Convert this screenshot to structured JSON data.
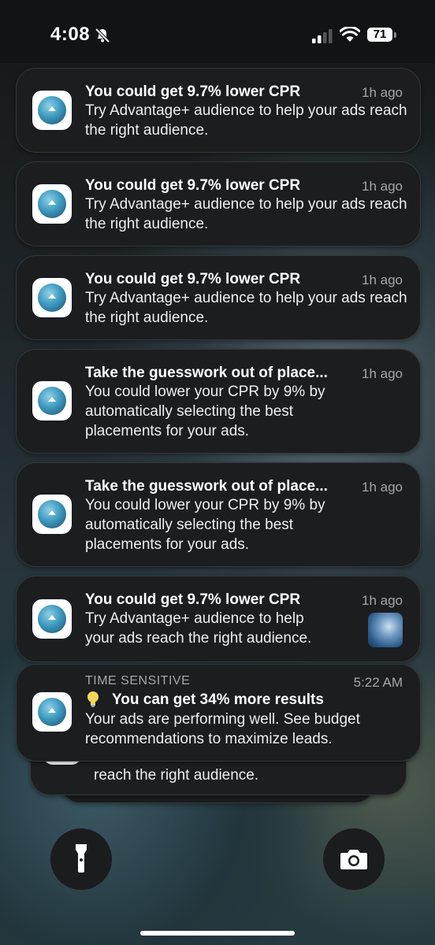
{
  "status_bar": {
    "time": "4:08",
    "battery": "71",
    "icons": [
      "bell-slash-icon",
      "cellular-signal-icon",
      "wifi-icon",
      "battery-icon"
    ]
  },
  "notifications": [
    {
      "title": "You could get 9.7% lower CPR",
      "time": "1h ago",
      "body": "Try Advantage+ audience to help your ads reach the right audience."
    },
    {
      "title": "You could get 9.7% lower CPR",
      "time": "1h ago",
      "body": "Try Advantage+ audience to help your ads reach the right audience."
    },
    {
      "title": "You could get 9.7% lower CPR",
      "time": "1h ago",
      "body": "Try Advantage+ audience to help your ads reach the right audience."
    },
    {
      "title": "Take the guesswork out of place...",
      "time": "1h ago",
      "body": "You could lower your CPR by 9% by automatically selecting the best placements for your ads."
    },
    {
      "title": "Take the guesswork out of place...",
      "time": "1h ago",
      "body": "You could lower your CPR by 9% by automatically selecting the best placements for your ads."
    },
    {
      "title": "You could get 9.7% lower CPR",
      "time": "1h ago",
      "body_line1": "Try Advantage+ audience to help",
      "body_line2": "your ads reach the right audience."
    }
  ],
  "time_sensitive": {
    "label": "TIME SENSITIVE",
    "time": "5:22 AM",
    "title": "You can get 34% more results",
    "body": "Your ads are performing well. See budget recommendations to maximize leads."
  },
  "stacked_behind": {
    "body_visible": "reach the right audience."
  },
  "lock_screen": {
    "left_button": "flashlight-icon",
    "right_button": "camera-icon"
  },
  "colors": {
    "card_bg": "#1b1d1f",
    "secondary_text": "#a4a7aa",
    "app_icon_accent": "#3e9ac0"
  }
}
